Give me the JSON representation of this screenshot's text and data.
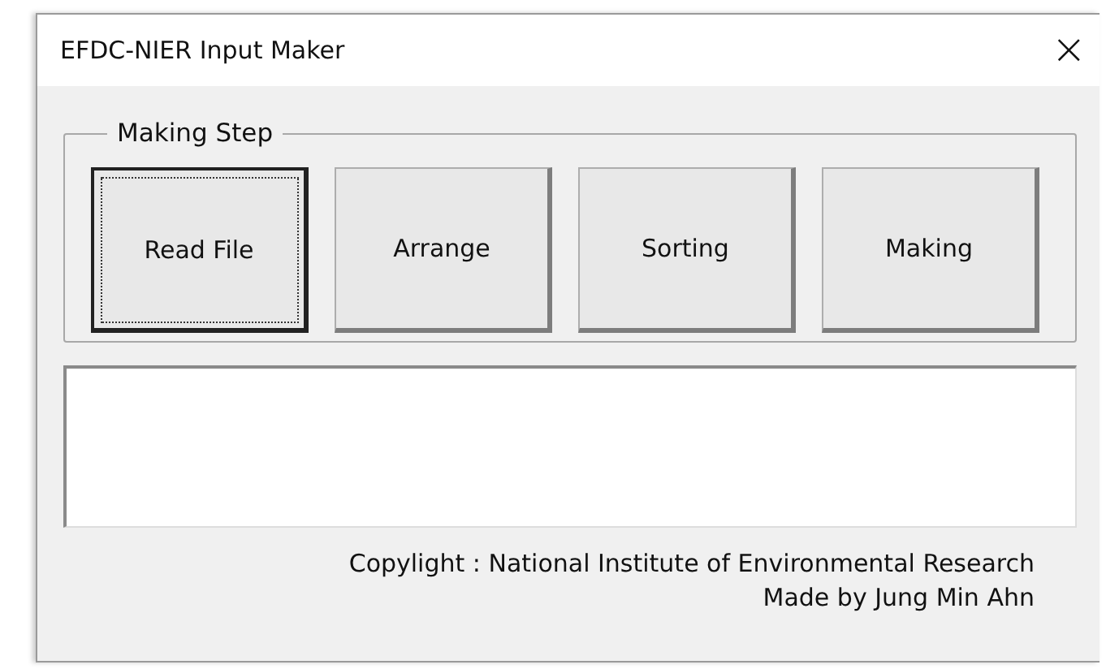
{
  "window": {
    "title": "EFDC-NIER Input Maker",
    "close": "×"
  },
  "group": {
    "label": "Making Step",
    "buttons": [
      {
        "label": "Read File",
        "focused": true
      },
      {
        "label": "Arrange",
        "focused": false
      },
      {
        "label": "Sorting",
        "focused": false
      },
      {
        "label": "Making",
        "focused": false
      }
    ]
  },
  "footer": [
    "Copylight : National Institute of Environmental Research",
    "Made by Jung Min Ahn"
  ]
}
